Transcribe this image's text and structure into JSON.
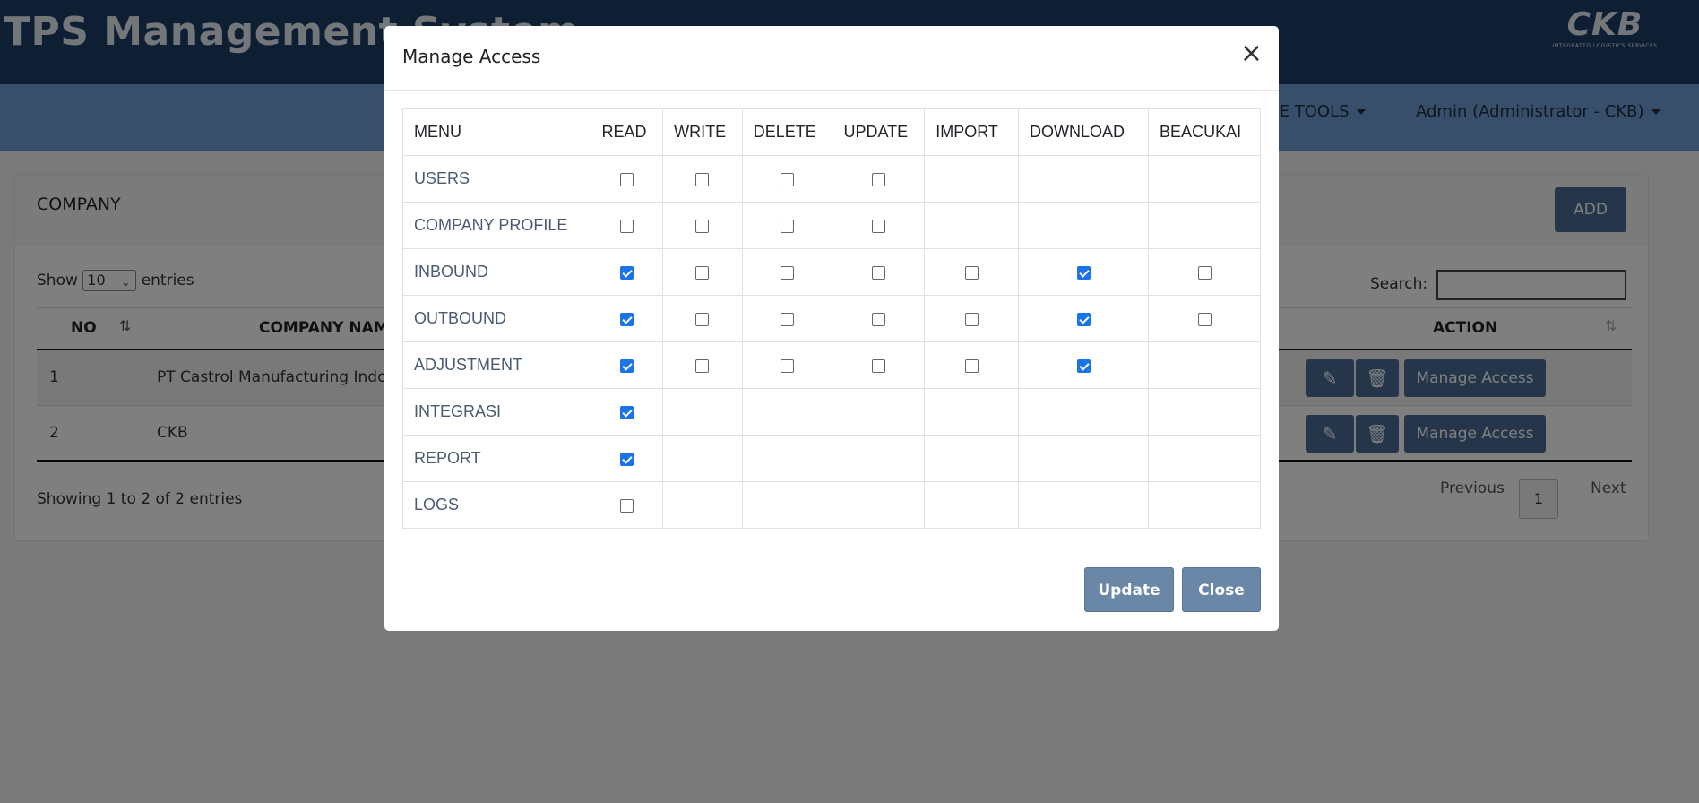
{
  "app": {
    "title": "TPS Management System",
    "logo_text": "CKB",
    "logo_subtitle": "INTEGRATED LOGISTICS SERVICES"
  },
  "navbar": {
    "tools_label": "IVE TOOLS",
    "user_label": "Admin (Administrator - CKB)"
  },
  "card": {
    "title": "COMPANY",
    "add_label": "ADD",
    "show_label": "Show",
    "entries_value": "10",
    "entries_label": "entries",
    "search_label": "Search:",
    "columns": {
      "no": "NO",
      "company_name": "COMPANY NAME",
      "action": "ACTION"
    },
    "rows": [
      {
        "no": "1",
        "name": "PT Castrol Manufacturing Indonesia",
        "manage": "Manage Access"
      },
      {
        "no": "2",
        "name": "CKB",
        "manage": "Manage Access"
      }
    ],
    "info": "Showing 1 to 2 of 2 entries",
    "pager": {
      "previous": "Previous",
      "current": "1",
      "next": "Next"
    }
  },
  "modal": {
    "title": "Manage Access",
    "close_symbol": "×",
    "headers": [
      "MENU",
      "READ",
      "WRITE",
      "DELETE",
      "UPDATE",
      "IMPORT",
      "DOWNLOAD",
      "BEACUKAI"
    ],
    "rows": [
      {
        "menu": "USERS",
        "perms": [
          false,
          false,
          false,
          false,
          null,
          null,
          null
        ]
      },
      {
        "menu": "COMPANY PROFILE",
        "perms": [
          false,
          false,
          false,
          false,
          null,
          null,
          null
        ]
      },
      {
        "menu": "INBOUND",
        "perms": [
          true,
          false,
          false,
          false,
          false,
          true,
          false
        ]
      },
      {
        "menu": "OUTBOUND",
        "perms": [
          true,
          false,
          false,
          false,
          false,
          true,
          false
        ]
      },
      {
        "menu": "ADJUSTMENT",
        "perms": [
          true,
          false,
          false,
          false,
          false,
          true,
          null
        ]
      },
      {
        "menu": "INTEGRASI",
        "perms": [
          true,
          null,
          null,
          null,
          null,
          null,
          null
        ]
      },
      {
        "menu": "REPORT",
        "perms": [
          true,
          null,
          null,
          null,
          null,
          null,
          null
        ]
      },
      {
        "menu": "LOGS",
        "perms": [
          false,
          null,
          null,
          null,
          null,
          null,
          null
        ]
      }
    ],
    "update_label": "Update",
    "close_label": "Close"
  }
}
